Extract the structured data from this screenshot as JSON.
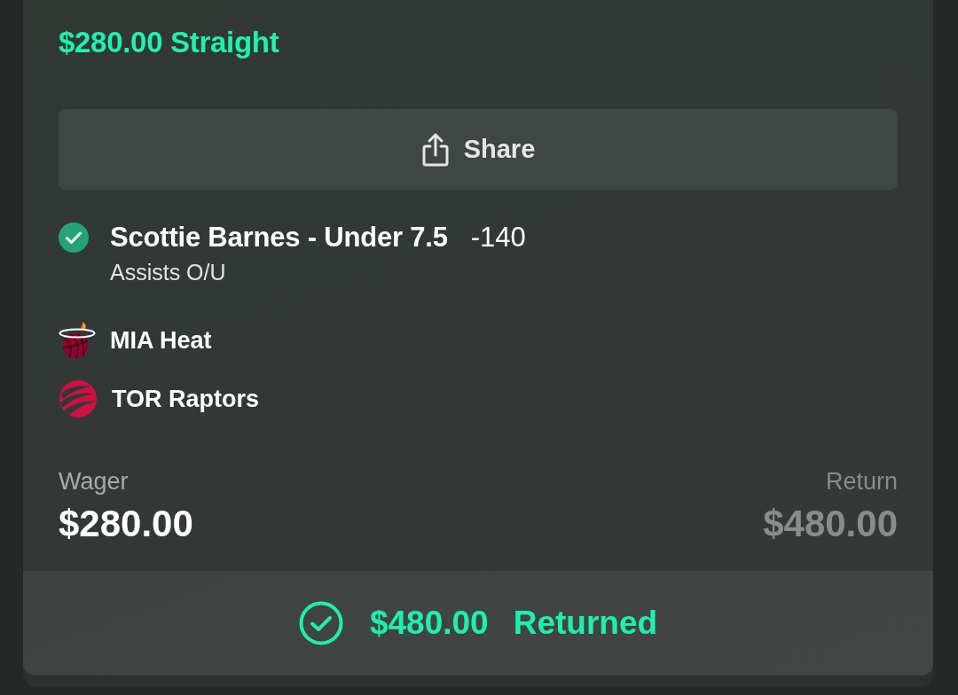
{
  "bet": {
    "title": "$280.00 Straight",
    "share_button": "Share"
  },
  "selection": {
    "won": true,
    "label": "Scottie Barnes - Under 7.5",
    "odds": "-140",
    "market": "Assists O/U"
  },
  "teams": [
    {
      "name": "MIA Heat"
    },
    {
      "name": "TOR Raptors"
    }
  ],
  "summary": {
    "wager_label": "Wager",
    "wager": "$280.00",
    "return_label": "Return",
    "return": "$480.00"
  },
  "result": {
    "amount": "$480.00",
    "status": "Returned"
  }
}
